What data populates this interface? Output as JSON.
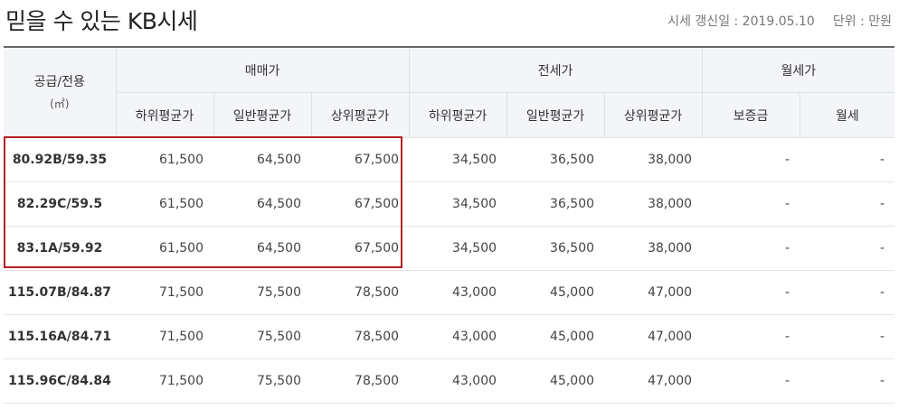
{
  "header": {
    "title": "믿을 수 있는 KB시세",
    "update_label": "시세 갱신일 : 2019.05.10",
    "unit_label": "단위 : 만원"
  },
  "table": {
    "supply_header": "공급/전용",
    "supply_unit": "(㎡)",
    "groups": {
      "sale": "매매가",
      "jeonse": "전세가",
      "monthly": "월세가"
    },
    "subheaders": {
      "sale_low": "하위평균가",
      "sale_mid": "일반평균가",
      "sale_high": "상위평균가",
      "jeonse_low": "하위평균가",
      "jeonse_mid": "일반평균가",
      "jeonse_high": "상위평균가",
      "deposit": "보증금",
      "monthly_rent": "월세"
    },
    "rows": [
      {
        "area": "80.92B/59.35",
        "sale_low": "61,500",
        "sale_mid": "64,500",
        "sale_high": "67,500",
        "jeonse_low": "34,500",
        "jeonse_mid": "36,500",
        "jeonse_high": "38,000",
        "deposit": "-",
        "monthly": "-"
      },
      {
        "area": "82.29C/59.5",
        "sale_low": "61,500",
        "sale_mid": "64,500",
        "sale_high": "67,500",
        "jeonse_low": "34,500",
        "jeonse_mid": "36,500",
        "jeonse_high": "38,000",
        "deposit": "-",
        "monthly": "-"
      },
      {
        "area": "83.1A/59.92",
        "sale_low": "61,500",
        "sale_mid": "64,500",
        "sale_high": "67,500",
        "jeonse_low": "34,500",
        "jeonse_mid": "36,500",
        "jeonse_high": "38,000",
        "deposit": "-",
        "monthly": "-"
      },
      {
        "area": "115.07B/84.87",
        "sale_low": "71,500",
        "sale_mid": "75,500",
        "sale_high": "78,500",
        "jeonse_low": "43,000",
        "jeonse_mid": "45,000",
        "jeonse_high": "47,000",
        "deposit": "-",
        "monthly": "-"
      },
      {
        "area": "115.16A/84.71",
        "sale_low": "71,500",
        "sale_mid": "75,500",
        "sale_high": "78,500",
        "jeonse_low": "43,000",
        "jeonse_mid": "45,000",
        "jeonse_high": "47,000",
        "deposit": "-",
        "monthly": "-"
      },
      {
        "area": "115.96C/84.84",
        "sale_low": "71,500",
        "sale_mid": "75,500",
        "sale_high": "78,500",
        "jeonse_low": "43,000",
        "jeonse_mid": "45,000",
        "jeonse_high": "47,000",
        "deposit": "-",
        "monthly": "-"
      }
    ]
  },
  "colors": {
    "highlight": "#b52025",
    "header_bg": "#f3f5f9"
  }
}
